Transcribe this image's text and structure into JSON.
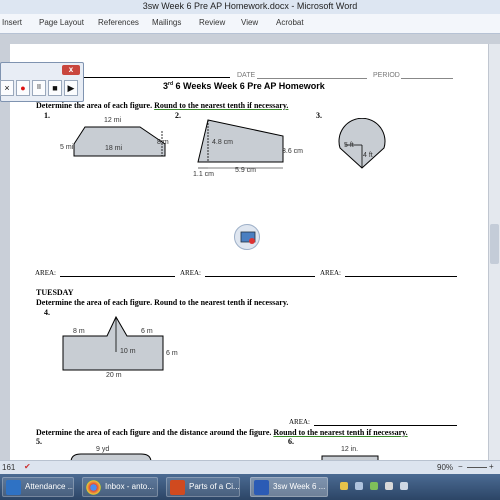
{
  "window": {
    "title": "3sw Week 6 Pre AP Homework.docx - Microsoft Word"
  },
  "ribbon": {
    "tabs": [
      "Insert",
      "Page Layout",
      "References",
      "Mailings",
      "Review",
      "View",
      "Acrobat"
    ]
  },
  "recorder": {
    "close_label": "x",
    "buttons": [
      "×",
      "●",
      "II",
      "■",
      "▶"
    ]
  },
  "doc": {
    "date_label": "DATE",
    "period_label": "PERIOD",
    "heading_sup": "rd",
    "heading_pre": "3",
    "heading_rest": " 6 Weeks Week 6 Pre AP Homework",
    "instruction1_pre": "Determine the area of each figure.",
    "instruction1_ul": "Round to the nearest tenth if necessary.",
    "problem_numbers": [
      "1.",
      "2.",
      "3.",
      "4.",
      "5.",
      "6."
    ],
    "fig1": {
      "top": "12 mi",
      "left": "5 mi",
      "base": "18 mi",
      "right": "8 m"
    },
    "fig2": {
      "height": "4.8 cm",
      "right": "3.6 cm",
      "left_base": "1.1 cm",
      "base": "5.9 cm"
    },
    "fig3": {
      "a": "5 ft",
      "b": "4 ft"
    },
    "area_label": "AREA:",
    "tuesday": "TUESDAY",
    "instruction2": "Determine the area of each figure. Round to the nearest tenth if necessary.",
    "fig4": {
      "left": "8 m",
      "right": "6 m",
      "height": "10 m",
      "side": "6 m",
      "base": "20 m"
    },
    "instruction3_pre": "Determine the area of each figure and the distance around the figure.",
    "instruction3_ul": "Round to the nearest tenth if necessary.",
    "fig5": {
      "label": "9 yd"
    },
    "fig6": {
      "label": "12 in."
    }
  },
  "statusbar": {
    "words": "161",
    "zoom": "90%"
  },
  "taskbar": {
    "items": [
      "Attendance ...",
      "Inbox - anto...",
      "Parts of a Ci...",
      "3sw Week 6 ..."
    ]
  }
}
